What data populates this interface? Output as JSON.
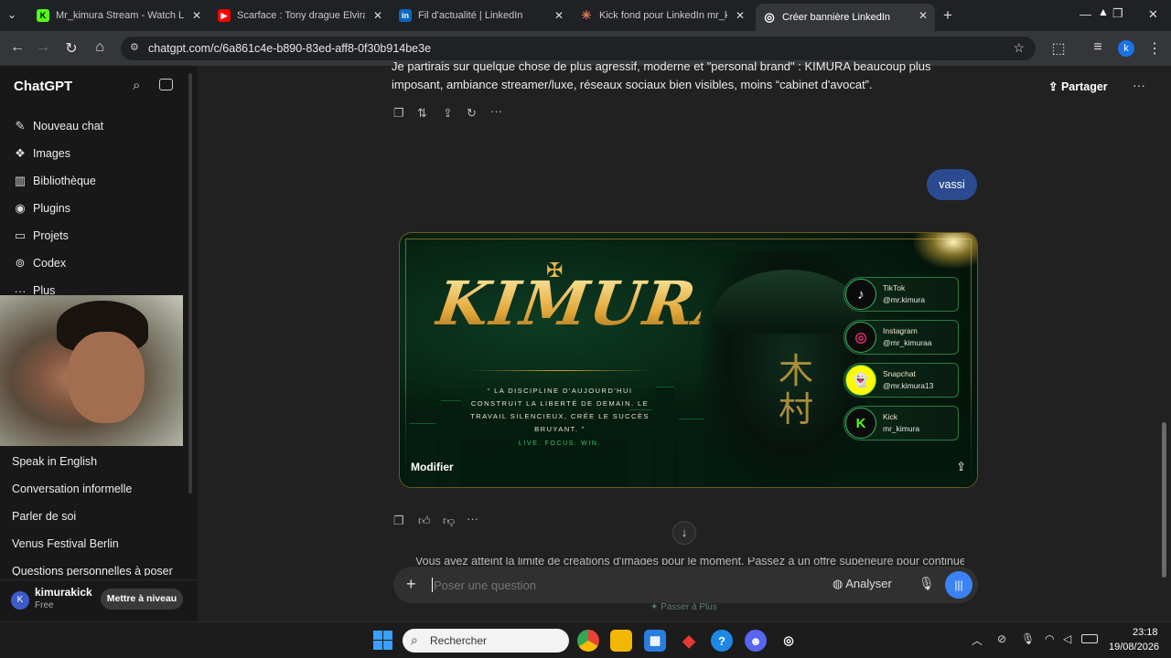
{
  "tabs": [
    {
      "title": "Mr_kimura Stream - Watch Live",
      "fav": "K",
      "fav_color": "#53fc18",
      "active": false
    },
    {
      "title": "Scarface : Tony drague Elvira C",
      "fav": "▶",
      "fav_color": "#ff0000",
      "active": false
    },
    {
      "title": "Fil d'actualité | LinkedIn",
      "fav": "in",
      "fav_color": "#0a66c2",
      "active": false
    },
    {
      "title": "Kick fond pour LinkedIn mr_kim",
      "fav": "✳",
      "fav_color": "#d97757",
      "active": false
    },
    {
      "title": "Créer bannière LinkedIn",
      "fav": "◎",
      "fav_color": "#ffffff",
      "active": true
    }
  ],
  "url": "chatgpt.com/c/6a861c4e-b890-83ed-aff8-0f30b914be3e",
  "profile_initial": "k",
  "sidebar": {
    "brand": "ChatGPT",
    "items": [
      {
        "label": "Nouveau chat",
        "icon": "edit-icon"
      },
      {
        "label": "Images",
        "icon": "images-icon"
      },
      {
        "label": "Bibliothèque",
        "icon": "library-icon"
      },
      {
        "label": "Plugins",
        "icon": "plugins-icon"
      },
      {
        "label": "Projets",
        "icon": "folder-icon"
      },
      {
        "label": "Codex",
        "icon": "codex-icon"
      },
      {
        "label": "Plus",
        "icon": "more-icon"
      }
    ],
    "history": [
      "Speak in English",
      "Conversation informelle",
      "Parler de soi",
      "Venus Festival Berlin",
      "Questions personnelles à poser"
    ],
    "user": {
      "name": "kimurakick",
      "plan": "Free",
      "initial": "K",
      "upgrade": "Mettre à niveau"
    }
  },
  "header": {
    "share": "Partager"
  },
  "messages": {
    "assistant_text_line1": "Je partirais sur quelque chose de plus agressif, moderne et \"personal brand\" : KIMURA beaucoup plus",
    "assistant_text_line2": "imposant, ambiance streamer/luxe, réseaux sociaux bien visibles, moins “cabinet d'avocat”.",
    "user_bubble": "vassi",
    "bottom_text": "Vous avez atteint la limite de créations d'images pour le moment. Passez à un offre supérieure pour continuer..."
  },
  "banner": {
    "logo": "KIMURA",
    "quote": "“ LA DISCIPLINE D'AUJOURD'HUI CONSTRUIT LA LIBERTÉ DE DEMAIN. LE TRAVAIL SILENCIEUX, CRÉE LE SUCCÈS BRUYANT. ”",
    "tagline": "LIVE. FOCUS. WIN.",
    "kanji": "木村",
    "modifier": "Modifier",
    "socials": [
      {
        "name": "TikTok",
        "handle": "@mr.kimura",
        "icon": "tiktok-icon",
        "glyph": "♪",
        "color": "#ffffff"
      },
      {
        "name": "Instagram",
        "handle": "@mr_kimuraa",
        "icon": "instagram-icon",
        "glyph": "◎",
        "color": "#e1306c"
      },
      {
        "name": "Snapchat",
        "handle": "@mr.kimura13",
        "icon": "snapchat-icon",
        "glyph": "👻",
        "color": "#fffc00"
      },
      {
        "name": "Kick",
        "handle": "mr_kimura",
        "icon": "kick-icon",
        "glyph": "K",
        "color": "#53fc18"
      }
    ]
  },
  "composer": {
    "placeholder": "Poser une question",
    "analyze": "Analyser",
    "upgrade_hint": "Passer à Plus"
  },
  "taskbar": {
    "search": "Rechercher",
    "time": "23:18",
    "date": "19/08/2026"
  }
}
